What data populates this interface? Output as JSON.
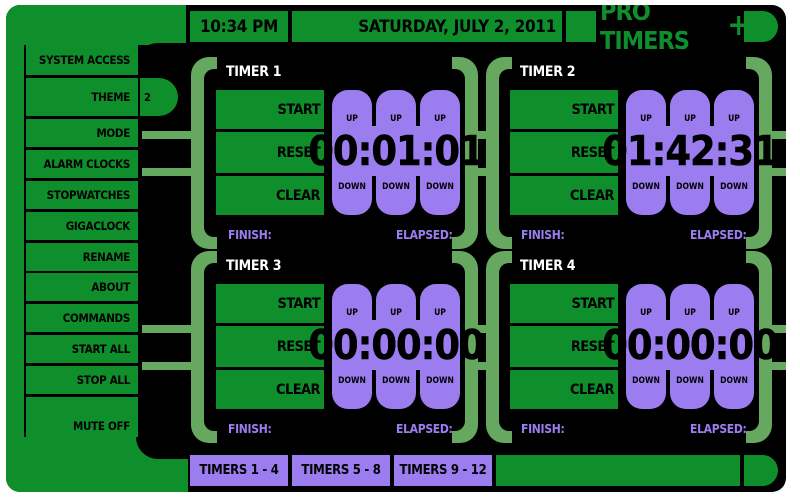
{
  "header": {
    "time": "10:34 PM",
    "date": "SATURDAY, JULY 2, 2011",
    "app_title": "PRO TIMERS",
    "plus": "+"
  },
  "sidebar": {
    "items": [
      {
        "label": "SYSTEM ACCESS"
      },
      {
        "label": "THEME",
        "value": "2"
      },
      {
        "label": "MODE"
      },
      {
        "label": "ALARM CLOCKS"
      },
      {
        "label": "STOPWATCHES"
      },
      {
        "label": "GIGACLOCK"
      },
      {
        "label": "RENAME"
      },
      {
        "label": "ABOUT"
      },
      {
        "label": "COMMANDS"
      },
      {
        "label": "START ALL"
      },
      {
        "label": "STOP ALL"
      },
      {
        "label": "MUTE OFF"
      }
    ]
  },
  "timers": [
    {
      "name": "TIMER 1",
      "time": "00:01:01",
      "start": "START",
      "reset": "RESET",
      "clear": "CLEAR",
      "up": "UP",
      "down": "DOWN",
      "finish": "FINISH:",
      "elapsed": "ELAPSED:"
    },
    {
      "name": "TIMER 2",
      "time": "01:42:31",
      "start": "START",
      "reset": "RESET",
      "clear": "CLEAR",
      "up": "UP",
      "down": "DOWN",
      "finish": "FINISH:",
      "elapsed": "ELAPSED:"
    },
    {
      "name": "TIMER 3",
      "time": "00:00:00",
      "start": "START",
      "reset": "RESET",
      "clear": "CLEAR",
      "up": "UP",
      "down": "DOWN",
      "finish": "FINISH:",
      "elapsed": "ELAPSED:"
    },
    {
      "name": "TIMER 4",
      "time": "00:00:00",
      "start": "START",
      "reset": "RESET",
      "clear": "CLEAR",
      "up": "UP",
      "down": "DOWN",
      "finish": "FINISH:",
      "elapsed": "ELAPSED:"
    }
  ],
  "bottom_tabs": [
    {
      "label": "TIMERS 1 - 4"
    },
    {
      "label": "TIMERS 5 - 8"
    },
    {
      "label": "TIMERS 9 - 12"
    }
  ],
  "colors": {
    "green": "#0f8f2b",
    "light_green": "#66a85f",
    "purple": "#9b7df0",
    "background": "#000000"
  }
}
